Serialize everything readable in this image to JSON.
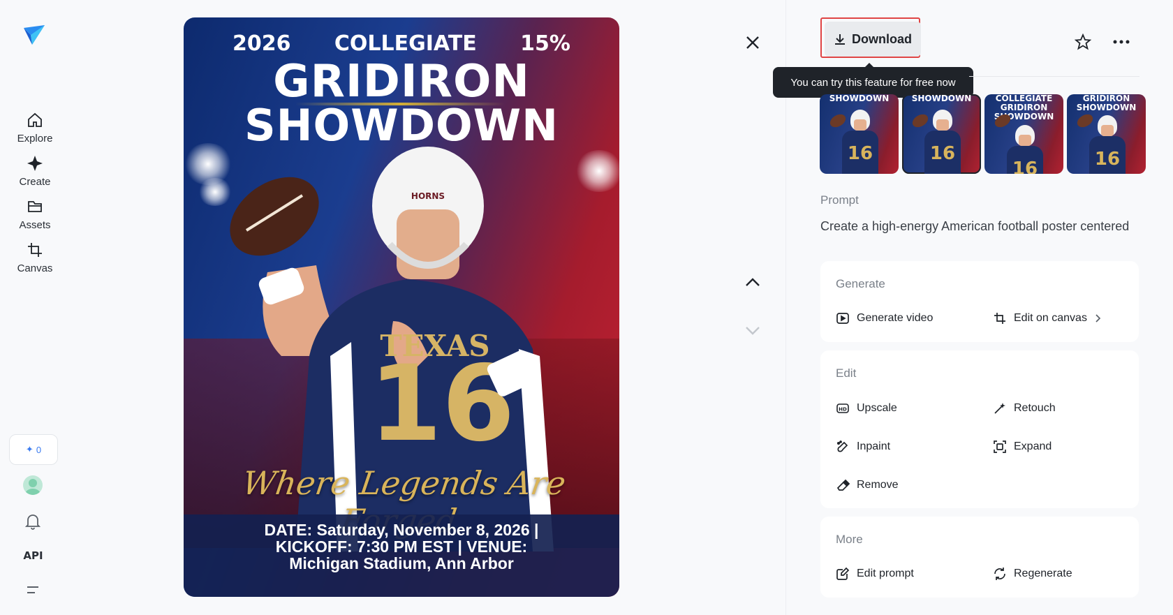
{
  "sidebar": {
    "items": [
      {
        "label": "Explore",
        "icon": "home-icon"
      },
      {
        "label": "Create",
        "icon": "sparkle-icon"
      },
      {
        "label": "Assets",
        "icon": "folder-icon"
      },
      {
        "label": "Canvas",
        "icon": "crop-icon"
      }
    ],
    "credits": "0",
    "api_label": "API"
  },
  "poster": {
    "year": "2026",
    "league": "COLLEGIATE",
    "percent": "15%",
    "title_line1": "GRIDIRON",
    "title_line2": "SHOWDOWN",
    "tagline": "Where Legends Are Forged",
    "jersey_text": "TEXAS",
    "jersey_number": "16",
    "helmet_text": "HORNS",
    "footer_line1": "DATE: Saturday, November 8, 2026 |",
    "footer_line2": "KICKOFF: 7:30 PM EST | VENUE:",
    "footer_line3": "Michigan Stadium, Ann Arbor"
  },
  "toolbar": {
    "download_label": "Download",
    "tooltip": "You can try this feature for free now"
  },
  "thumbnails": [
    {
      "title": "SHOWDOWN",
      "num": "16"
    },
    {
      "title": "SHOWDOWN",
      "num": "16"
    },
    {
      "title": "COLLEGIATE GRIDIRON SHOWDOWN",
      "num": "16"
    },
    {
      "title": "GRIDIRON SHOWDOWN",
      "num": "16"
    }
  ],
  "prompt": {
    "label": "Prompt",
    "text": "Create a high-energy American football poster centered"
  },
  "generate": {
    "title": "Generate",
    "generate_video": "Generate video",
    "edit_on_canvas": "Edit on canvas"
  },
  "edit": {
    "title": "Edit",
    "upscale": "Upscale",
    "retouch": "Retouch",
    "inpaint": "Inpaint",
    "expand": "Expand",
    "remove": "Remove"
  },
  "more": {
    "title": "More",
    "edit_prompt": "Edit prompt",
    "regenerate": "Regenerate"
  },
  "colors": {
    "accent": "#3a7bf0",
    "highlight_border": "#e04444",
    "tooltip_bg": "#1f2329",
    "gold": "#d9b45a"
  }
}
